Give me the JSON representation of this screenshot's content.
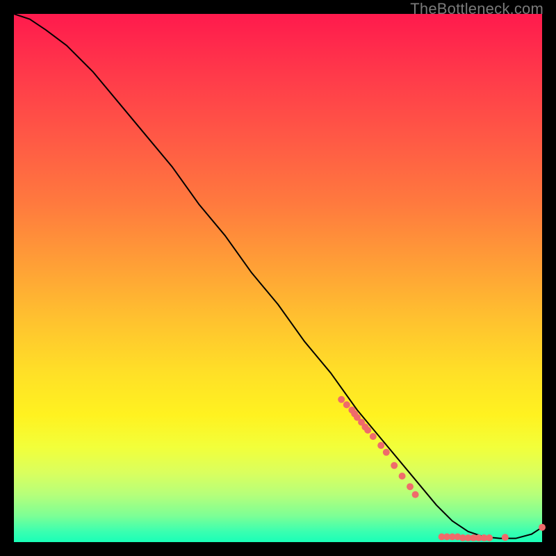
{
  "watermark": "TheBottleneck.com",
  "chart_data": {
    "type": "line",
    "title": "",
    "xlabel": "",
    "ylabel": "",
    "xlim": [
      0,
      100
    ],
    "ylim": [
      0,
      100
    ],
    "grid": false,
    "legend": false,
    "background": {
      "gradient_dir": "vertical",
      "top_color": "#ff1a4d",
      "bottom_color": "#19ffb8"
    },
    "series": [
      {
        "name": "bottleneck-curve",
        "color": "#000000",
        "x": [
          0,
          3,
          6,
          10,
          15,
          20,
          25,
          30,
          35,
          40,
          45,
          50,
          55,
          60,
          65,
          70,
          75,
          80,
          83,
          86,
          89,
          92,
          95,
          98,
          100
        ],
        "y": [
          100,
          99,
          97,
          94,
          89,
          83,
          77,
          71,
          64,
          58,
          51,
          45,
          38,
          32,
          25,
          19,
          13,
          7,
          4,
          2,
          1,
          0.7,
          0.7,
          1.5,
          2.8
        ]
      }
    ],
    "points": [
      {
        "name": "cluster-mid-1",
        "x": 62,
        "y": 27
      },
      {
        "name": "cluster-mid-2",
        "x": 63,
        "y": 26
      },
      {
        "name": "cluster-mid-3",
        "x": 64,
        "y": 25
      },
      {
        "name": "cluster-mid-4",
        "x": 64.5,
        "y": 24.3
      },
      {
        "name": "cluster-mid-5",
        "x": 65,
        "y": 23.6
      },
      {
        "name": "cluster-mid-6",
        "x": 65.8,
        "y": 22.7
      },
      {
        "name": "cluster-mid-7",
        "x": 66.5,
        "y": 21.8
      },
      {
        "name": "cluster-mid-8",
        "x": 67,
        "y": 21.2
      },
      {
        "name": "cluster-mid-9",
        "x": 68,
        "y": 20
      },
      {
        "name": "cluster-mid-10",
        "x": 69.5,
        "y": 18.3
      },
      {
        "name": "cluster-mid-11",
        "x": 70.5,
        "y": 17
      },
      {
        "name": "cluster-low-1",
        "x": 72,
        "y": 14.5
      },
      {
        "name": "cluster-low-2",
        "x": 73.5,
        "y": 12.5
      },
      {
        "name": "cluster-low-3",
        "x": 75,
        "y": 10.5
      },
      {
        "name": "cluster-low-4",
        "x": 76,
        "y": 9
      },
      {
        "name": "bottom-1",
        "x": 81,
        "y": 1
      },
      {
        "name": "bottom-2",
        "x": 82,
        "y": 1
      },
      {
        "name": "bottom-3",
        "x": 83,
        "y": 1
      },
      {
        "name": "bottom-4",
        "x": 84,
        "y": 1
      },
      {
        "name": "bottom-5",
        "x": 85,
        "y": 0.8
      },
      {
        "name": "bottom-6",
        "x": 86,
        "y": 0.8
      },
      {
        "name": "bottom-7",
        "x": 87,
        "y": 0.8
      },
      {
        "name": "bottom-8",
        "x": 88,
        "y": 0.8
      },
      {
        "name": "bottom-9",
        "x": 89,
        "y": 0.8
      },
      {
        "name": "bottom-10",
        "x": 90,
        "y": 0.8
      },
      {
        "name": "bottom-11",
        "x": 93,
        "y": 0.9
      },
      {
        "name": "end-up",
        "x": 100,
        "y": 2.8
      }
    ],
    "point_color": "#ef6b6b",
    "point_radius": 5
  }
}
